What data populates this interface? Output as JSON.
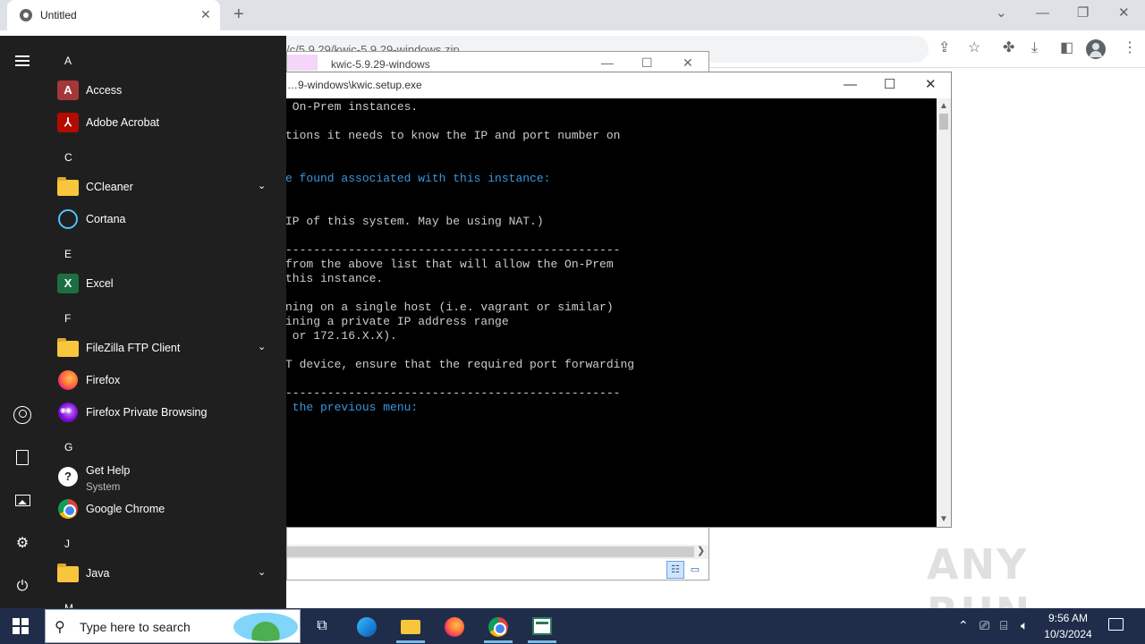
{
  "browser": {
    "tab_title": "Untitled",
    "url": "/c/5.9.29/kwic-5.9.29-windows.zip",
    "new_tab_glyph": "+",
    "tab_close_glyph": "✕"
  },
  "explorer": {
    "title": "kwic-5.9.29-windows"
  },
  "console": {
    "title": "…9-windows\\kwic.setup.exe",
    "lines": [
      {
        "text": " On-Prem instances.",
        "color": "gray"
      },
      {
        "text": "tions it needs to know the IP and port number on",
        "color": "gray"
      },
      {
        "text": "e found associated with this instance:",
        "color": "cyan"
      },
      {
        "text": "IP of this system. May be using NAT.)",
        "color": "gray"
      },
      {
        "text": "------------------------------------------------",
        "color": "gray"
      },
      {
        "text": "from the above list that will allow the On-Prem",
        "color": "gray"
      },
      {
        "text": "this instance.",
        "color": "gray"
      },
      {
        "text": "ning on a single host (i.e. vagrant or similar)",
        "color": "gray"
      },
      {
        "text": "ining a private IP address range",
        "color": "gray"
      },
      {
        "text": " or 172.16.X.X).",
        "color": "gray"
      },
      {
        "text": "T device, ensure that the required port forwarding",
        "color": "gray"
      },
      {
        "text": "------------------------------------------------",
        "color": "gray"
      },
      {
        "text": " the previous menu:",
        "color": "cyan"
      }
    ]
  },
  "start_menu": {
    "rail": [
      {
        "name": "expand-menu-icon"
      },
      {
        "name": "user-account-icon"
      },
      {
        "name": "documents-icon"
      },
      {
        "name": "pictures-icon"
      },
      {
        "name": "settings-icon",
        "glyph": "⚙"
      },
      {
        "name": "power-icon",
        "glyph": "⏻"
      }
    ],
    "letters": [
      "A",
      "C",
      "E",
      "F",
      "G",
      "J",
      "M"
    ],
    "apps": [
      {
        "label": "Access",
        "icon": "access-icon",
        "glyph": "A"
      },
      {
        "label": "Adobe Acrobat",
        "icon": "acrobat-icon",
        "glyph": "⅄"
      },
      {
        "label": "CCleaner",
        "icon": "folder-icon",
        "expandable": true
      },
      {
        "label": "Cortana",
        "icon": "cortana-icon"
      },
      {
        "label": "Excel",
        "icon": "excel-icon",
        "glyph": "X"
      },
      {
        "label": "FileZilla FTP Client",
        "icon": "folder-icon",
        "expandable": true
      },
      {
        "label": "Firefox",
        "icon": "firefox-icon"
      },
      {
        "label": "Firefox Private Browsing",
        "icon": "firefox-private-icon"
      },
      {
        "label": "Get Help",
        "sublabel": "System",
        "icon": "get-help-icon",
        "glyph": "?"
      },
      {
        "label": "Google Chrome",
        "icon": "chrome-icon"
      },
      {
        "label": "Java",
        "icon": "folder-icon",
        "expandable": true
      }
    ]
  },
  "watermark": "ANY RUN",
  "taskbar": {
    "search_placeholder": "Type here to search",
    "clock_time": "9:56 AM",
    "clock_date": "10/3/2024",
    "active_app": "kwic-setup"
  }
}
